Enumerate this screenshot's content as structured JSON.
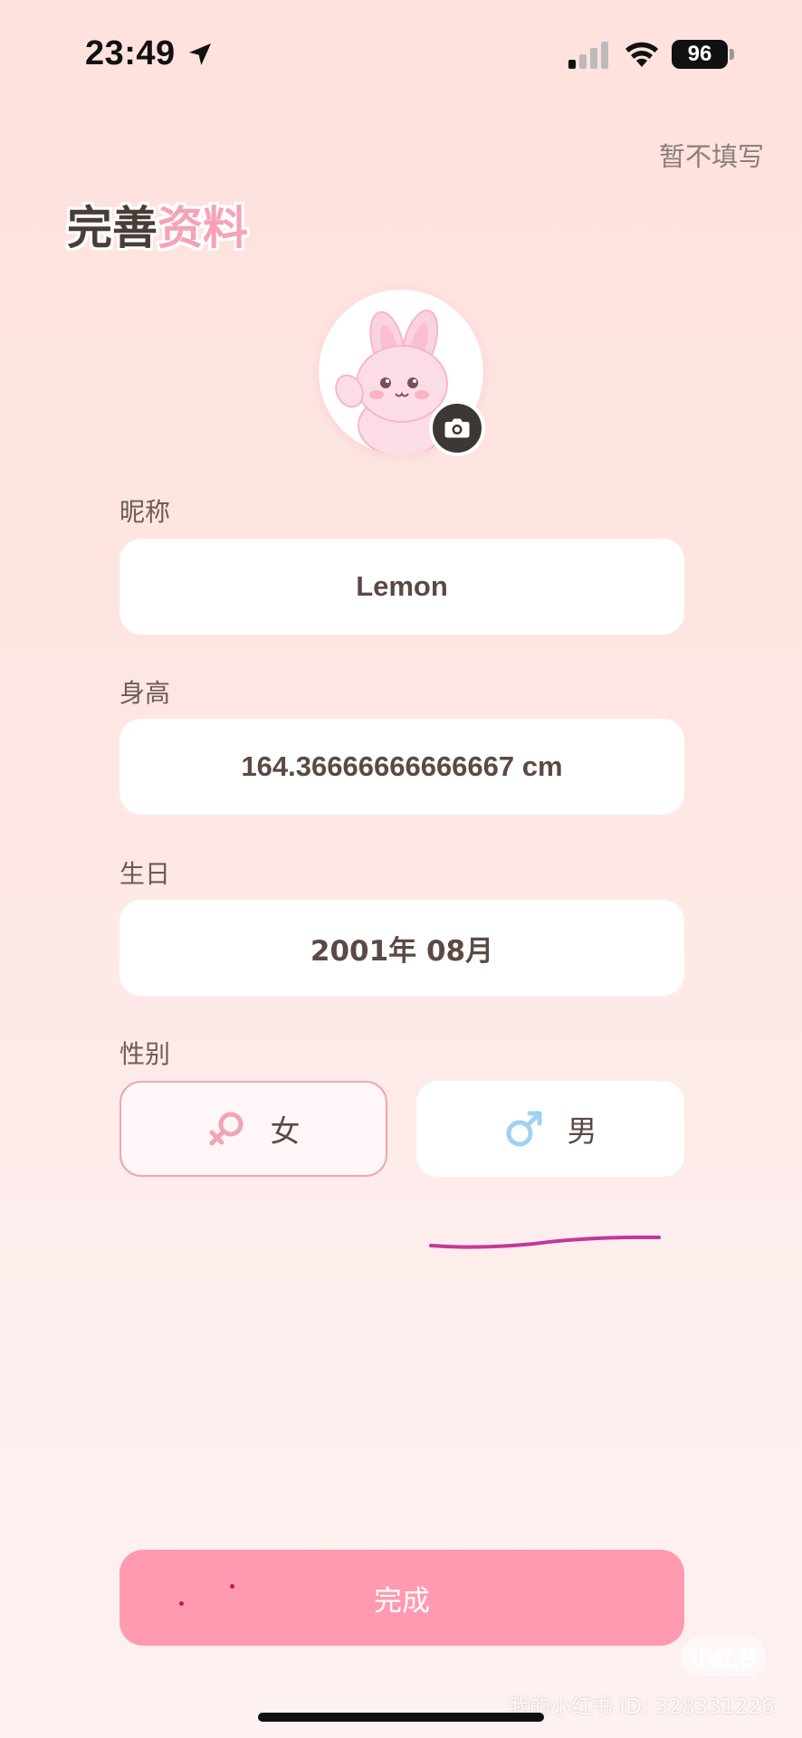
{
  "status_bar": {
    "time": "23:49",
    "battery": "96",
    "icons": [
      "location-arrow-icon",
      "cellular-signal-icon",
      "wifi-icon",
      "battery-icon"
    ]
  },
  "header": {
    "skip_label": "暂不填写",
    "title_part1": "完善",
    "title_part2": "资料"
  },
  "avatar": {
    "image": "bunny-avatar",
    "edit_icon": "camera-icon"
  },
  "form": {
    "nickname": {
      "label": "昵称",
      "value": "Lemon"
    },
    "height": {
      "label": "身高",
      "value": "164.36666666666667 cm"
    },
    "birthday": {
      "label": "生日",
      "value": "2001年 08月"
    },
    "gender": {
      "label": "性别",
      "options": [
        {
          "label": "女",
          "icon": "female-symbol-icon",
          "selected": true
        },
        {
          "label": "男",
          "icon": "male-symbol-icon",
          "selected": false
        }
      ]
    }
  },
  "actions": {
    "done_label": "完成"
  },
  "watermark": {
    "logo": "小红书",
    "text": "我的小红书 ID: 328331226"
  },
  "colors": {
    "accent_pink": "#ff9ab0",
    "title_pink": "#f6a2b7",
    "female_blue_icon": "#f1a4b4",
    "male_icon": "#9fd2f0",
    "text_dark": "#5b4a44"
  }
}
